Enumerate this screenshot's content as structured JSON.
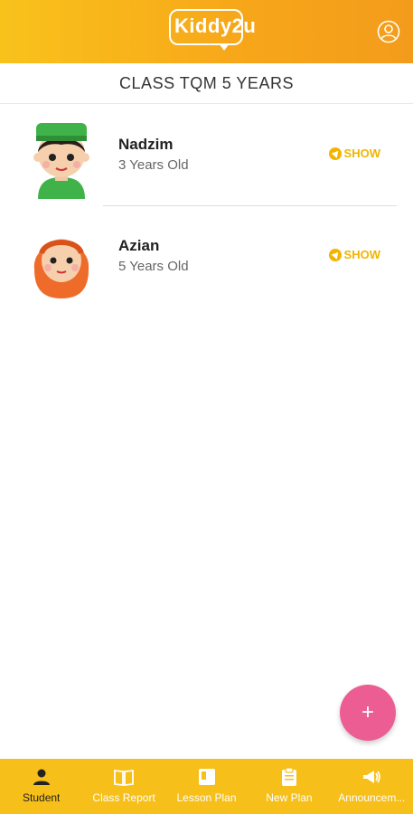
{
  "header": {
    "logo_text": "Kiddy2u",
    "profile_icon": "user-circle-icon",
    "class_title": "CLASS TQM 5 YEARS"
  },
  "students": [
    {
      "name": "Nadzim",
      "age": "3 Years Old",
      "action": "SHOW"
    },
    {
      "name": "Azian",
      "age": "5 Years Old",
      "action": "SHOW"
    }
  ],
  "fab": {
    "label": "+"
  },
  "bottom_nav": {
    "items": [
      {
        "label": "Student",
        "icon": "person-icon",
        "active": true
      },
      {
        "label": "Class Report",
        "icon": "book-icon",
        "active": false
      },
      {
        "label": "Lesson Plan",
        "icon": "notebook-icon",
        "active": false
      },
      {
        "label": "New Plan",
        "icon": "clipboard-icon",
        "active": false
      },
      {
        "label": "Announcem...",
        "icon": "megaphone-icon",
        "active": false
      }
    ]
  },
  "colors": {
    "header_gradient_start": "#f9c21b",
    "header_gradient_end": "#f39c1b",
    "accent_yellow": "#f2b400",
    "fab_pink": "#ec5d93",
    "bottom_nav": "#f6bf19"
  }
}
